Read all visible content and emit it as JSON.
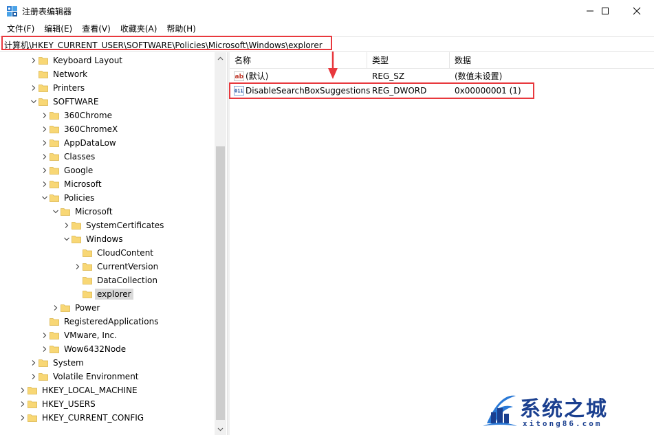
{
  "window": {
    "title": "注册表编辑器",
    "minimize_label": "",
    "maximize_label": "",
    "close_label": ""
  },
  "menu": [
    "文件(F)",
    "编辑(E)",
    "查看(V)",
    "收藏夹(A)",
    "帮助(H)"
  ],
  "address": "计算机\\HKEY_CURRENT_USER\\SOFTWARE\\Policies\\Microsoft\\Windows\\explorer",
  "tree": [
    {
      "label": "Keyboard Layout",
      "level": 2,
      "expander": "collapsed"
    },
    {
      "label": "Network",
      "level": 2,
      "expander": "none"
    },
    {
      "label": "Printers",
      "level": 2,
      "expander": "collapsed"
    },
    {
      "label": "SOFTWARE",
      "level": 2,
      "expander": "expanded"
    },
    {
      "label": "360Chrome",
      "level": 3,
      "expander": "collapsed"
    },
    {
      "label": "360ChromeX",
      "level": 3,
      "expander": "collapsed"
    },
    {
      "label": "AppDataLow",
      "level": 3,
      "expander": "collapsed"
    },
    {
      "label": "Classes",
      "level": 3,
      "expander": "collapsed"
    },
    {
      "label": "Google",
      "level": 3,
      "expander": "collapsed"
    },
    {
      "label": "Microsoft",
      "level": 3,
      "expander": "collapsed"
    },
    {
      "label": "Policies",
      "level": 3,
      "expander": "expanded"
    },
    {
      "label": "Microsoft",
      "level": 4,
      "expander": "expanded"
    },
    {
      "label": "SystemCertificates",
      "level": 5,
      "expander": "collapsed"
    },
    {
      "label": "Windows",
      "level": 5,
      "expander": "expanded"
    },
    {
      "label": "CloudContent",
      "level": 6,
      "expander": "none"
    },
    {
      "label": "CurrentVersion",
      "level": 6,
      "expander": "collapsed"
    },
    {
      "label": "DataCollection",
      "level": 6,
      "expander": "none"
    },
    {
      "label": "explorer",
      "level": 6,
      "expander": "none",
      "selected": true
    },
    {
      "label": "Power",
      "level": 4,
      "expander": "collapsed"
    },
    {
      "label": "RegisteredApplications",
      "level": 3,
      "expander": "none"
    },
    {
      "label": "VMware, Inc.",
      "level": 3,
      "expander": "collapsed"
    },
    {
      "label": "Wow6432Node",
      "level": 3,
      "expander": "collapsed"
    },
    {
      "label": "System",
      "level": 2,
      "expander": "collapsed"
    },
    {
      "label": "Volatile Environment",
      "level": 2,
      "expander": "collapsed"
    },
    {
      "label": "HKEY_LOCAL_MACHINE",
      "level": 1,
      "expander": "collapsed"
    },
    {
      "label": "HKEY_USERS",
      "level": 1,
      "expander": "collapsed"
    },
    {
      "label": "HKEY_CURRENT_CONFIG",
      "level": 1,
      "expander": "collapsed"
    }
  ],
  "list": {
    "columns": [
      "名称",
      "类型",
      "数据"
    ],
    "rows": [
      {
        "name": "(默认)",
        "type": "REG_SZ",
        "data": "(数值未设置)",
        "icon": "string-value-icon"
      },
      {
        "name": "DisableSearchBoxSuggestions",
        "type": "REG_DWORD",
        "data": "0x00000001 (1)",
        "icon": "dword-value-icon"
      }
    ]
  },
  "icons": {
    "string_value_glyph": "ab",
    "dword_value_glyph": "011"
  },
  "watermark": {
    "brand": "系统之城",
    "url": "xitong86.com"
  },
  "colors": {
    "highlight_red": "#e8383d",
    "folder_yellow": "#f8d775",
    "watermark_blue": "#1a3f8f"
  }
}
